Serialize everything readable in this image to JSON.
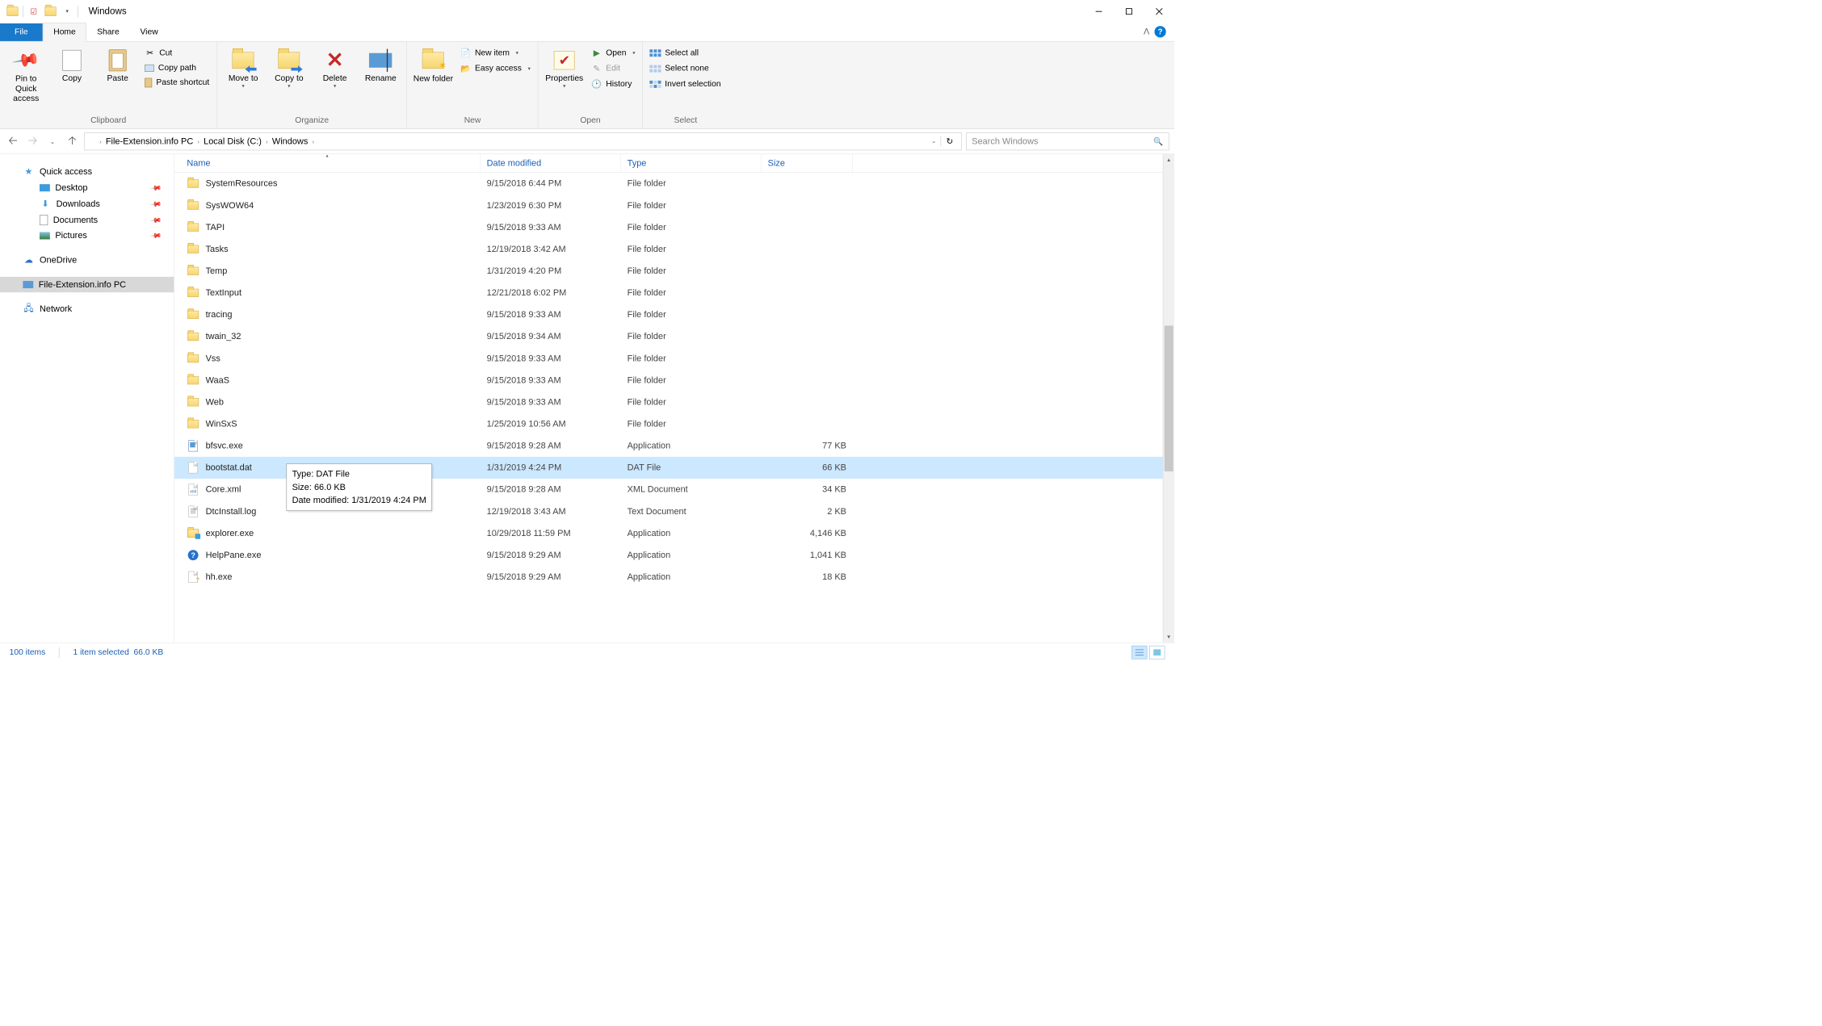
{
  "window": {
    "title": "Windows"
  },
  "tabs": {
    "file": "File",
    "home": "Home",
    "share": "Share",
    "view": "View"
  },
  "ribbon": {
    "clipboard": {
      "label": "Clipboard",
      "pin": "Pin to Quick access",
      "copy": "Copy",
      "paste": "Paste",
      "cut": "Cut",
      "copy_path": "Copy path",
      "paste_shortcut": "Paste shortcut"
    },
    "organize": {
      "label": "Organize",
      "move_to": "Move to",
      "copy_to": "Copy to",
      "delete": "Delete",
      "rename": "Rename"
    },
    "new": {
      "label": "New",
      "new_folder": "New folder",
      "new_item": "New item",
      "easy_access": "Easy access"
    },
    "open": {
      "label": "Open",
      "properties": "Properties",
      "open": "Open",
      "edit": "Edit",
      "history": "History"
    },
    "select": {
      "label": "Select",
      "select_all": "Select all",
      "select_none": "Select none",
      "invert": "Invert selection"
    }
  },
  "breadcrumb": {
    "root": "File-Extension.info PC",
    "drive": "Local Disk (C:)",
    "folder": "Windows"
  },
  "search": {
    "placeholder": "Search Windows"
  },
  "nav": {
    "quick_access": "Quick access",
    "desktop": "Desktop",
    "downloads": "Downloads",
    "documents": "Documents",
    "pictures": "Pictures",
    "onedrive": "OneDrive",
    "this_pc": "File-Extension.info PC",
    "network": "Network"
  },
  "columns": {
    "name": "Name",
    "date": "Date modified",
    "type": "Type",
    "size": "Size"
  },
  "files": [
    {
      "icon": "folder",
      "name": "SystemResources",
      "date": "9/15/2018 6:44 PM",
      "type": "File folder",
      "size": ""
    },
    {
      "icon": "folder",
      "name": "SysWOW64",
      "date": "1/23/2019 6:30 PM",
      "type": "File folder",
      "size": ""
    },
    {
      "icon": "folder",
      "name": "TAPI",
      "date": "9/15/2018 9:33 AM",
      "type": "File folder",
      "size": ""
    },
    {
      "icon": "folder",
      "name": "Tasks",
      "date": "12/19/2018 3:42 AM",
      "type": "File folder",
      "size": ""
    },
    {
      "icon": "folder",
      "name": "Temp",
      "date": "1/31/2019 4:20 PM",
      "type": "File folder",
      "size": ""
    },
    {
      "icon": "folder",
      "name": "TextInput",
      "date": "12/21/2018 6:02 PM",
      "type": "File folder",
      "size": ""
    },
    {
      "icon": "folder",
      "name": "tracing",
      "date": "9/15/2018 9:33 AM",
      "type": "File folder",
      "size": ""
    },
    {
      "icon": "folder",
      "name": "twain_32",
      "date": "9/15/2018 9:34 AM",
      "type": "File folder",
      "size": ""
    },
    {
      "icon": "folder",
      "name": "Vss",
      "date": "9/15/2018 9:33 AM",
      "type": "File folder",
      "size": ""
    },
    {
      "icon": "folder",
      "name": "WaaS",
      "date": "9/15/2018 9:33 AM",
      "type": "File folder",
      "size": ""
    },
    {
      "icon": "folder",
      "name": "Web",
      "date": "9/15/2018 9:33 AM",
      "type": "File folder",
      "size": ""
    },
    {
      "icon": "folder",
      "name": "WinSxS",
      "date": "1/25/2019 10:56 AM",
      "type": "File folder",
      "size": ""
    },
    {
      "icon": "exe",
      "name": "bfsvc.exe",
      "date": "9/15/2018 9:28 AM",
      "type": "Application",
      "size": "77 KB"
    },
    {
      "icon": "file",
      "name": "bootstat.dat",
      "date": "1/31/2019 4:24 PM",
      "type": "DAT File",
      "size": "66 KB",
      "selected": true
    },
    {
      "icon": "xml",
      "name": "Core.xml",
      "date": "9/15/2018 9:28 AM",
      "type": "XML Document",
      "size": "34 KB"
    },
    {
      "icon": "txt",
      "name": "DtcInstall.log",
      "date": "12/19/2018 3:43 AM",
      "type": "Text Document",
      "size": "2 KB"
    },
    {
      "icon": "explorer",
      "name": "explorer.exe",
      "date": "10/29/2018 11:59 PM",
      "type": "Application",
      "size": "4,146 KB"
    },
    {
      "icon": "help",
      "name": "HelpPane.exe",
      "date": "9/15/2018 9:29 AM",
      "type": "Application",
      "size": "1,041 KB"
    },
    {
      "icon": "hh",
      "name": "hh.exe",
      "date": "9/15/2018 9:29 AM",
      "type": "Application",
      "size": "18 KB"
    }
  ],
  "tooltip": {
    "line1": "Type: DAT File",
    "line2": "Size: 66.0 KB",
    "line3": "Date modified: 1/31/2019 4:24 PM"
  },
  "status": {
    "items": "100 items",
    "selected": "1 item selected",
    "size": "66.0 KB"
  }
}
